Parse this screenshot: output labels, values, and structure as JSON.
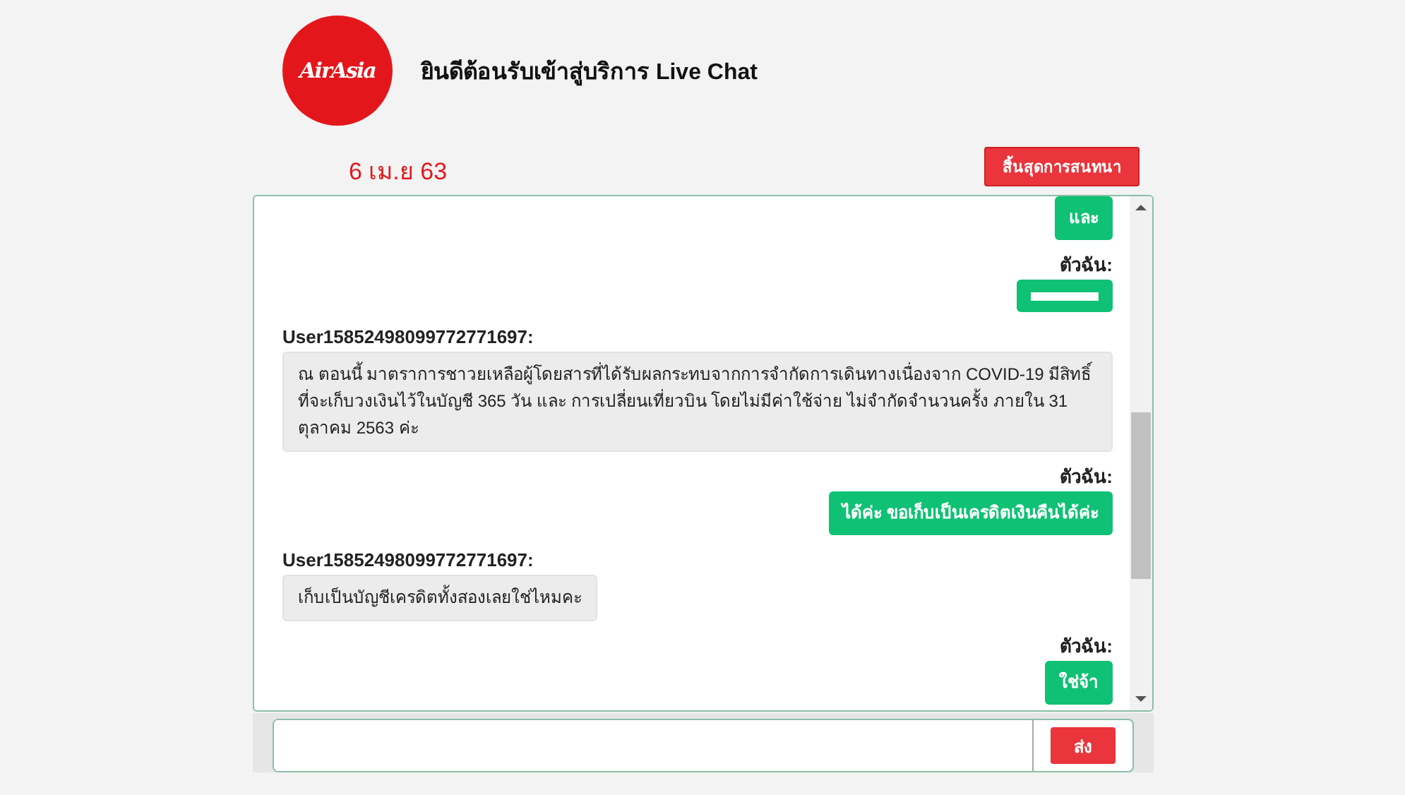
{
  "header": {
    "logo_text": "AirAsia",
    "title": "ยินดีต้อนรับเข้าสู่บริการ Live Chat"
  },
  "date": "6 เม.ย 63",
  "end_button": "สิ้นสุดการสนทนา",
  "messages": [
    {
      "kind": "my_bubble",
      "text": "และ"
    },
    {
      "kind": "my_sender",
      "text": "ตัวฉัน:"
    },
    {
      "kind": "my_redacted"
    },
    {
      "kind": "their_sender",
      "text": "User15852498099772771697:"
    },
    {
      "kind": "their_bubble",
      "text": "ณ ตอนนี้ มาตราการชาวยเหลือผู้โดยสารที่ได้รับผลกระทบจากการจำกัดการเดินทางเนื่องจาก COVID-19 มีสิทธิ์ที่จะเก็บวงเงินไว้ในบัญชี 365 วัน และ การเปลี่ยนเที่ยวบิน โดยไม่มีค่าใช้จ่าย ไม่จำกัดจำนวนครั้ง ภายใน 31 ตุลาคม 2563 ค่ะ"
    },
    {
      "kind": "my_sender",
      "text": "ตัวฉัน:"
    },
    {
      "kind": "my_bubble",
      "text": "ได้ค่ะ ขอเก็บเป็นเครดิตเงินคืนได้ค่ะ"
    },
    {
      "kind": "their_sender",
      "text": "User15852498099772771697:"
    },
    {
      "kind": "their_bubble",
      "text": "เก็บเป็นบัญชีเครดิตทั้งสองเลยใช่ไหมคะ"
    },
    {
      "kind": "my_sender",
      "text": "ตัวฉัน:"
    },
    {
      "kind": "my_bubble",
      "text": "ใช่จ้า"
    }
  ],
  "send_button": "ส่ง"
}
